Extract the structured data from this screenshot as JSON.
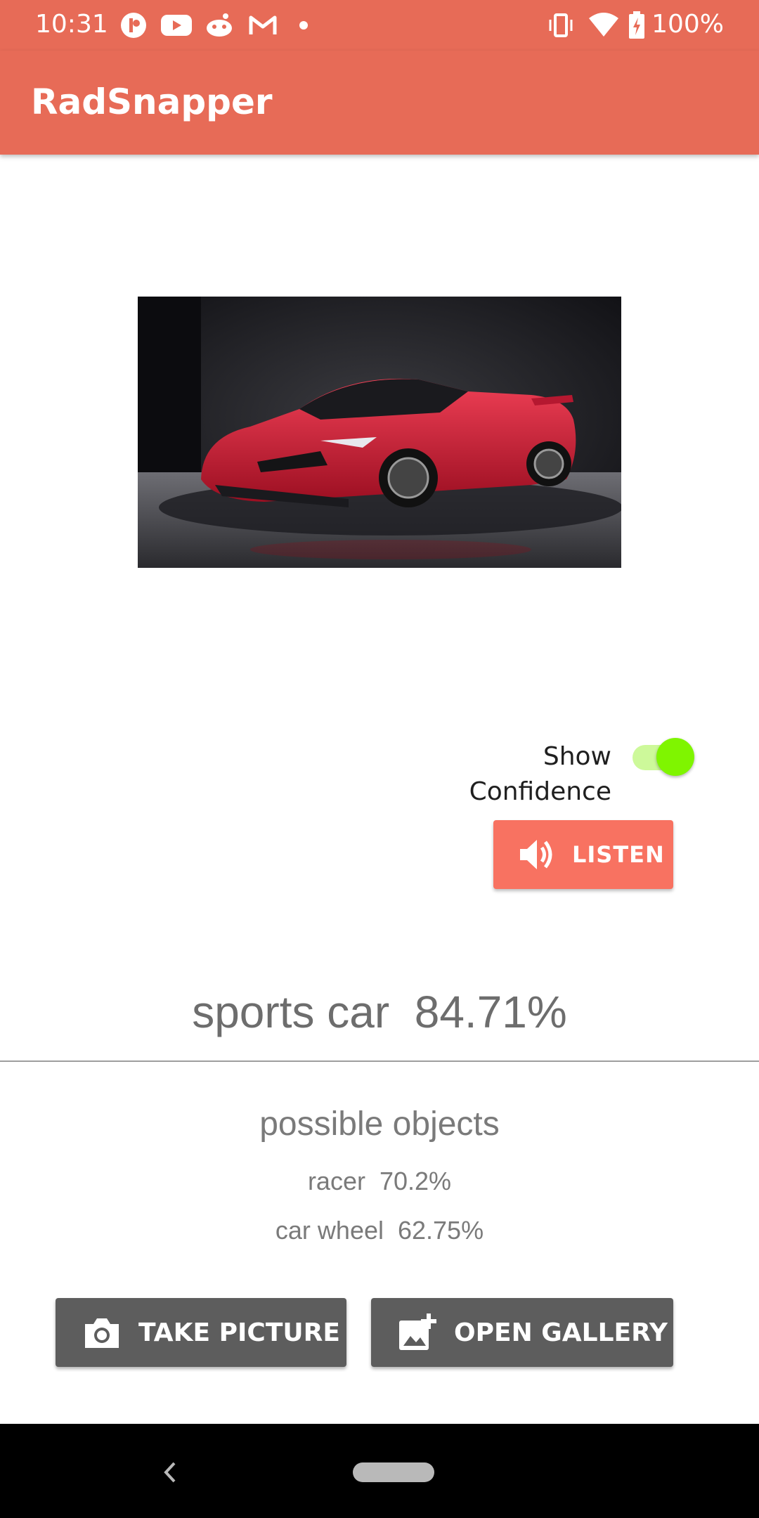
{
  "status_bar": {
    "time": "10:31",
    "battery": "100%",
    "left_icons": [
      "reddit-alt-icon",
      "youtube-icon",
      "reddit-icon",
      "gmail-icon",
      "dot-icon"
    ],
    "right_icons": [
      "vibrate-icon",
      "wifi-icon",
      "battery-charging-icon"
    ]
  },
  "app_bar": {
    "title": "RadSnapper",
    "color": "#e76b57"
  },
  "controls": {
    "toggle_label": "Show Confidence",
    "toggle_on": true,
    "listen_label": "LISTEN"
  },
  "result": {
    "top": "sports car  84.71%",
    "possible_title": "possible objects",
    "possible": [
      "racer  70.2%",
      "car wheel  62.75%"
    ]
  },
  "actions": {
    "take_picture": "TAKE PICTURE",
    "open_gallery": "OPEN GALLERY"
  }
}
